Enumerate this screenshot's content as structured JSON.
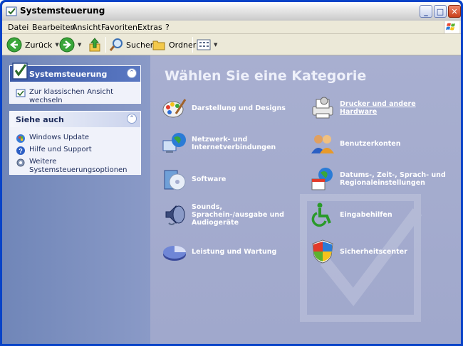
{
  "window": {
    "title": "Systemsteuerung"
  },
  "menubar": {
    "items": [
      "Datei",
      "Bearbeiten",
      "Ansicht",
      "Favoriten",
      "Extras",
      "?"
    ]
  },
  "toolbar": {
    "back_label": "Zurück",
    "search_label": "Suchen",
    "folders_label": "Ordner"
  },
  "taskpane": {
    "control_panel": {
      "title": "Systemsteuerung",
      "link": "Zur klassischen Ansicht wechseln"
    },
    "see_also": {
      "title": "Siehe auch",
      "links": [
        "Windows Update",
        "Hilfe und Support",
        "Weitere Systemsteuerungsoptionen"
      ]
    }
  },
  "main": {
    "heading": "Wählen Sie eine Kategorie",
    "categories": [
      "Darstellung und Designs",
      "Drucker und andere Hardware",
      "Netzwerk- und Internetverbindungen",
      "Benutzerkonten",
      "Software",
      "Datums-, Zeit-, Sprach- und Regionaleinstellungen",
      "Sounds, Sprachein-/ausgabe und Audiogeräte",
      "Eingabehilfen",
      "Leistung und Wartung",
      "Sicherheitscenter"
    ]
  },
  "colors": {
    "title_bg": "#d9d9d9",
    "taskpane_bg": "#7b8fc0",
    "main_bg": "#a4abce",
    "accent": "#3c5aa8"
  }
}
